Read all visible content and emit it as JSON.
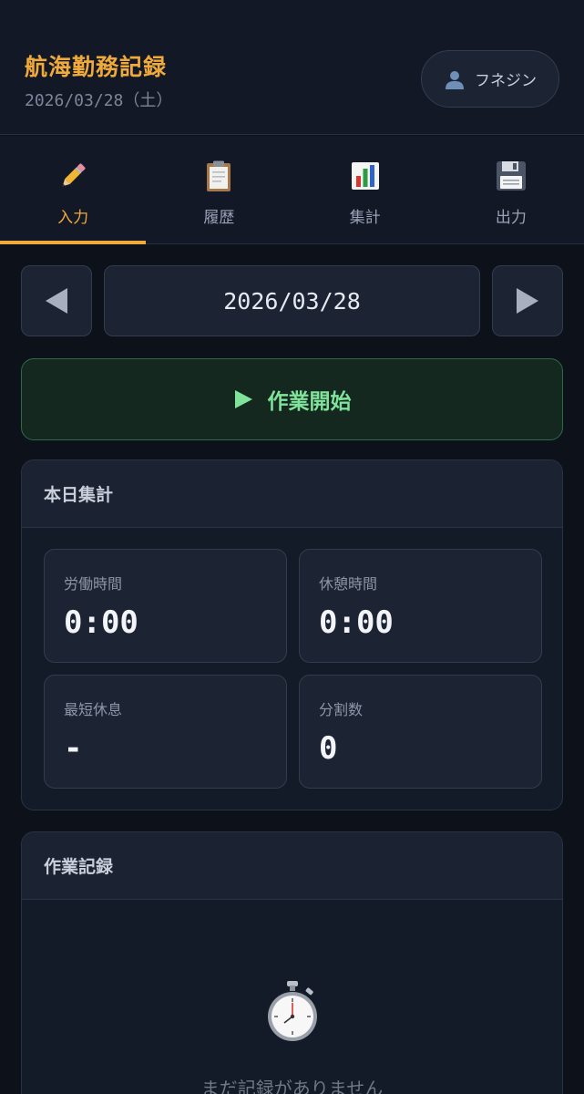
{
  "header": {
    "title": "航海勤務記録",
    "date": "2026/03/28（土）",
    "user_name": "フネジン"
  },
  "tabs": [
    {
      "label": "入力",
      "icon": "pencil-icon",
      "active": true
    },
    {
      "label": "履歴",
      "icon": "clipboard-icon",
      "active": false
    },
    {
      "label": "集計",
      "icon": "bar-chart-icon",
      "active": false
    },
    {
      "label": "出力",
      "icon": "floppy-disk-icon",
      "active": false
    }
  ],
  "date_nav": {
    "current_date": "2026/03/28"
  },
  "start_button": {
    "label": "作業開始"
  },
  "summary": {
    "title": "本日集計",
    "stats": [
      {
        "label": "労働時間",
        "value": "0:00"
      },
      {
        "label": "休憩時間",
        "value": "0:00"
      },
      {
        "label": "最短休息",
        "value": "-"
      },
      {
        "label": "分割数",
        "value": "0"
      }
    ]
  },
  "records": {
    "title": "作業記録",
    "empty_text": "まだ記録がありません"
  },
  "colors": {
    "accent": "#f0a93b",
    "background": "#0d1119",
    "panel": "#141b28",
    "start_green": "#7fe39b"
  }
}
